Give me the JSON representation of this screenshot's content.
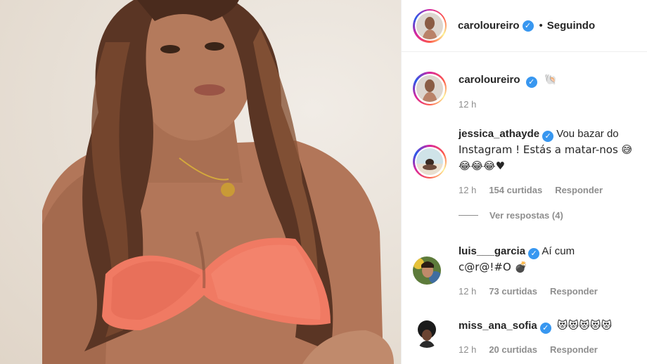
{
  "post": {
    "author": "caroloureiro",
    "follow_status": "Seguindo",
    "separator": "•"
  },
  "caption": {
    "author": "caroloureiro",
    "emoji": "🐚",
    "time": "12 h"
  },
  "comments": [
    {
      "user": "jessica_athayde",
      "text_line1": "Vou bazar do",
      "text_line2": "Instagram ! Estás a matar-nos 😅",
      "text_line3": "😂😂😂♥",
      "time": "12 h",
      "likes": "154 curtidas",
      "reply_label": "Responder",
      "view_replies": "Ver respostas (4)"
    },
    {
      "user": "luis___garcia",
      "text_line1": "Aí cum",
      "text_line2": "c@r@!#O 💣",
      "time": "12 h",
      "likes": "73 curtidas",
      "reply_label": "Responder"
    },
    {
      "user": "miss_ana_sofia",
      "text_line1": "😻😻😻😻😻",
      "time": "12 h",
      "likes": "20 curtidas",
      "reply_label": "Responder"
    }
  ],
  "icons": {
    "verified": "verified-badge-icon",
    "check": "✓"
  },
  "colors": {
    "verified_blue": "#3897f0",
    "meta_gray": "#8e8e8e",
    "text": "#262626"
  }
}
